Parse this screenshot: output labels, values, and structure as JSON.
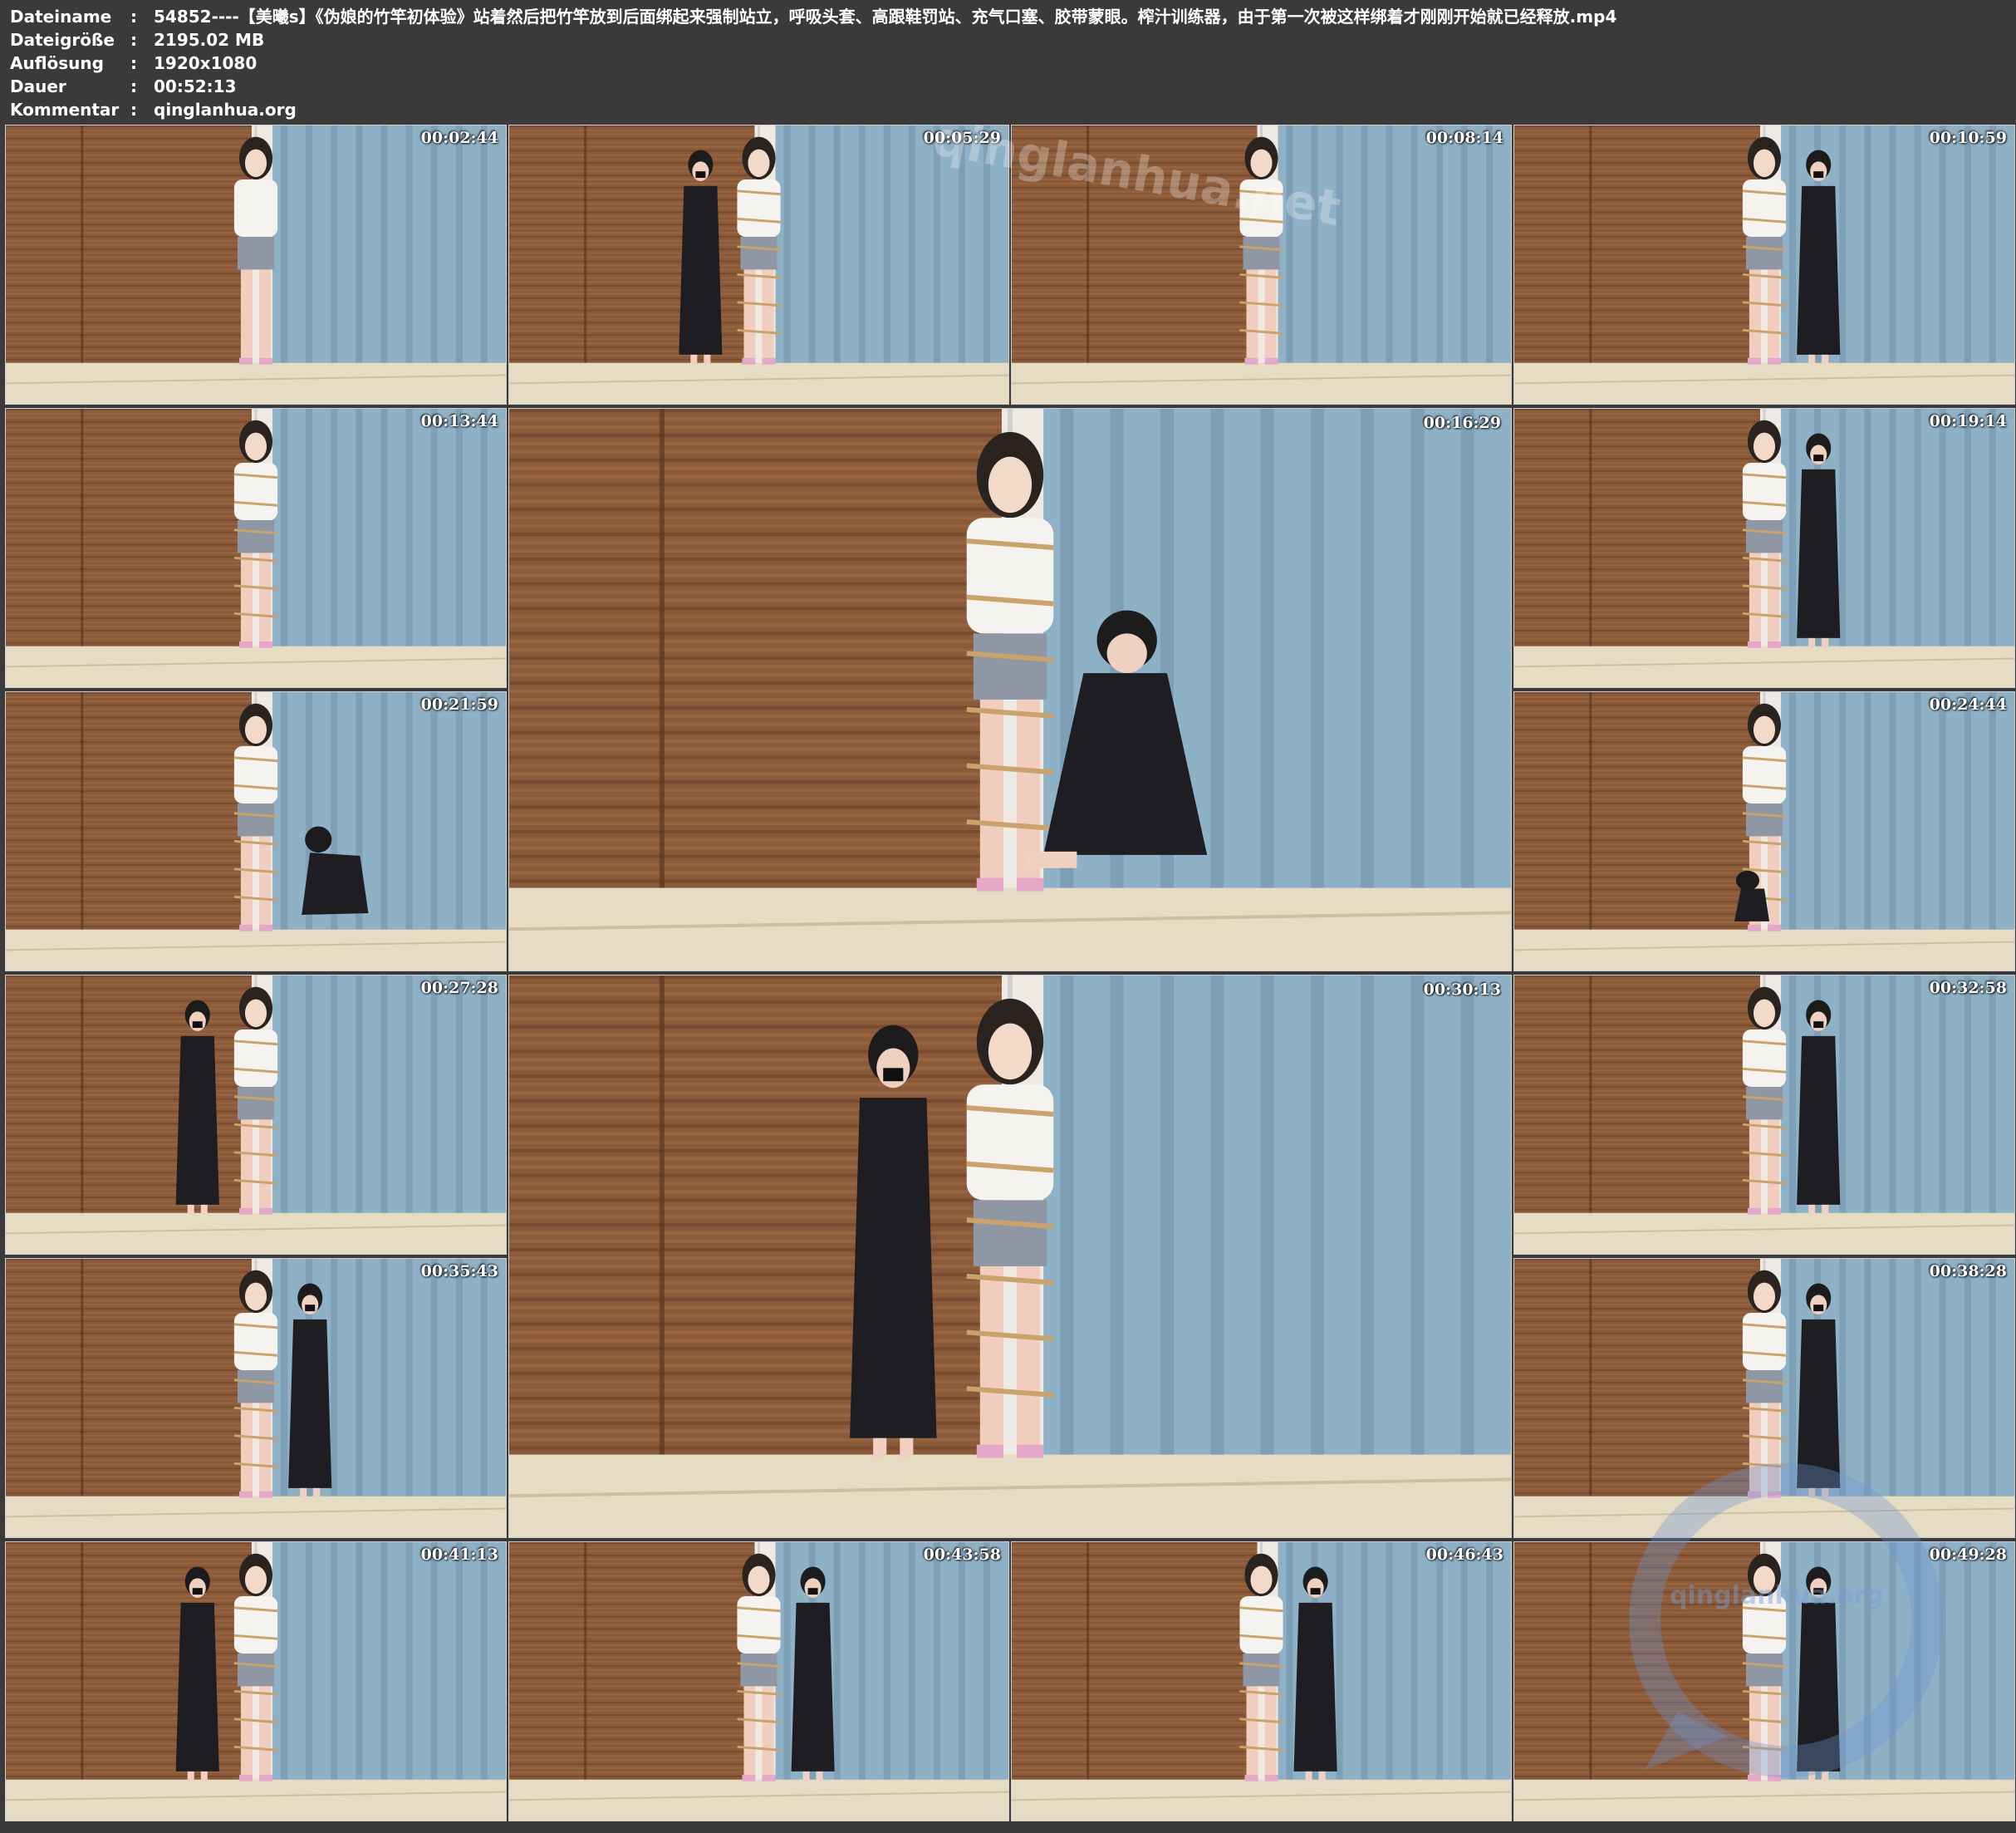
{
  "header": {
    "rows": [
      {
        "key": "Dateiname",
        "sep": ":",
        "value": "54852----【美曦s】《伪娘的竹竿初体验》站着然后把竹竿放到后面绑起来强制站立，呼吸头套、高跟鞋罚站、充气口塞、胶带蒙眼。榨汁训练器，由于第一次被这样绑着才刚刚开始就已经释放.mp4"
      },
      {
        "key": "Dateigröße",
        "sep": ":",
        "value": "2195.02 MB"
      },
      {
        "key": "Auflösung",
        "sep": ":",
        "value": "1920x1080"
      },
      {
        "key": "Dauer",
        "sep": ":",
        "value": "00:52:13"
      },
      {
        "key": "Kommentar",
        "sep": ":",
        "value": "qinglanhua.org"
      }
    ]
  },
  "thumbnails": [
    {
      "timestamp": "00:02:44",
      "scene": "standing-alone"
    },
    {
      "timestamp": "00:05:29",
      "scene": "assistant-left"
    },
    {
      "timestamp": "00:08:14",
      "scene": "standing-bound"
    },
    {
      "timestamp": "00:10:59",
      "scene": "assistant-behind"
    },
    {
      "timestamp": "00:13:44",
      "scene": "standing-bound"
    },
    {
      "timestamp": "00:16:29",
      "scene": "assistant-kneeling"
    },
    {
      "timestamp": "00:19:14",
      "scene": "assistant-behind"
    },
    {
      "timestamp": "00:21:59",
      "scene": "assistant-crawling"
    },
    {
      "timestamp": "00:24:44",
      "scene": "assistant-crouching"
    },
    {
      "timestamp": "00:27:28",
      "scene": "assistant-left"
    },
    {
      "timestamp": "00:30:13",
      "scene": "assistant-left"
    },
    {
      "timestamp": "00:32:58",
      "scene": "assistant-right"
    },
    {
      "timestamp": "00:35:43",
      "scene": "assistant-right"
    },
    {
      "timestamp": "00:38:28",
      "scene": "assistant-right"
    },
    {
      "timestamp": "00:41:13",
      "scene": "assistant-left"
    },
    {
      "timestamp": "00:43:58",
      "scene": "assistant-right"
    },
    {
      "timestamp": "00:46:43",
      "scene": "assistant-right"
    },
    {
      "timestamp": "00:49:28",
      "scene": "assistant-right"
    }
  ],
  "watermarks": {
    "top": "qinglanhua.net",
    "logo": "qinglanhua.org"
  },
  "colors": {
    "background": "#3a3a3a",
    "blind": "#8a5a3a",
    "curtain": "#8fb1c6",
    "floor": "#e6dcc4",
    "timestamp": "#ffffff"
  }
}
